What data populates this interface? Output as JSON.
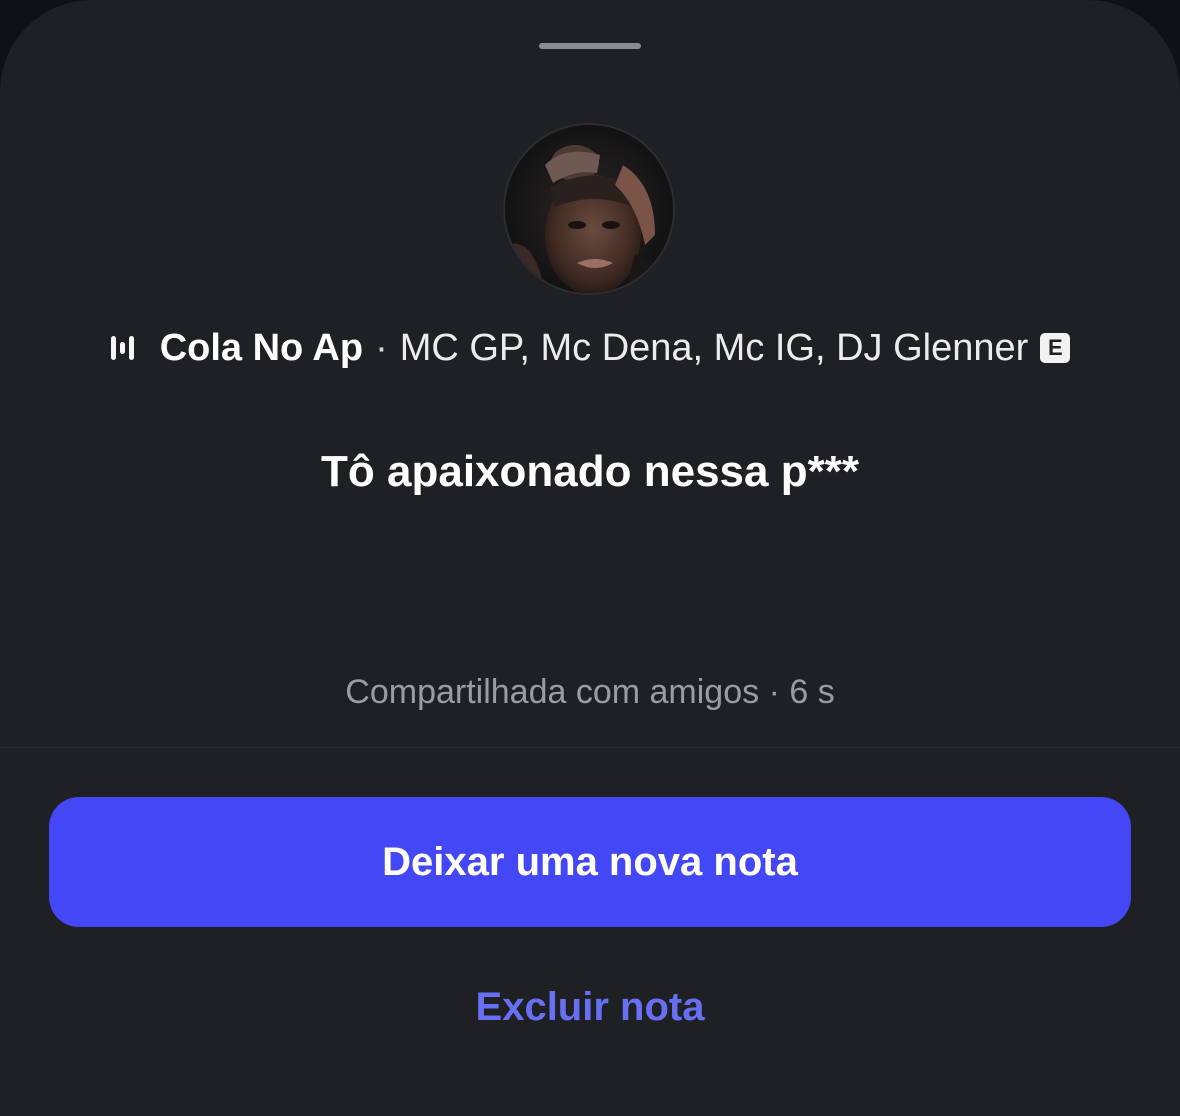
{
  "sheet": {
    "grabber_icon": "drag-handle"
  },
  "note": {
    "music": {
      "icon": "audio-bars-icon",
      "title": "Cola No Ap",
      "separator": "·",
      "artists": "MC GP, Mc Dena, Mc IG, DJ Glenner",
      "explicit_badge": "E"
    },
    "text": "Tô apaixonado nessa p***",
    "audience": "Compartilhada com amigos",
    "meta_separator": "·",
    "age": "6 s"
  },
  "actions": {
    "primary_label": "Deixar uma nova nota",
    "delete_label": "Excluir nota"
  },
  "colors": {
    "background": "#1e2024",
    "primary_button": "#4447f5",
    "link": "#6770f3",
    "muted_text": "#9a9ca1"
  }
}
